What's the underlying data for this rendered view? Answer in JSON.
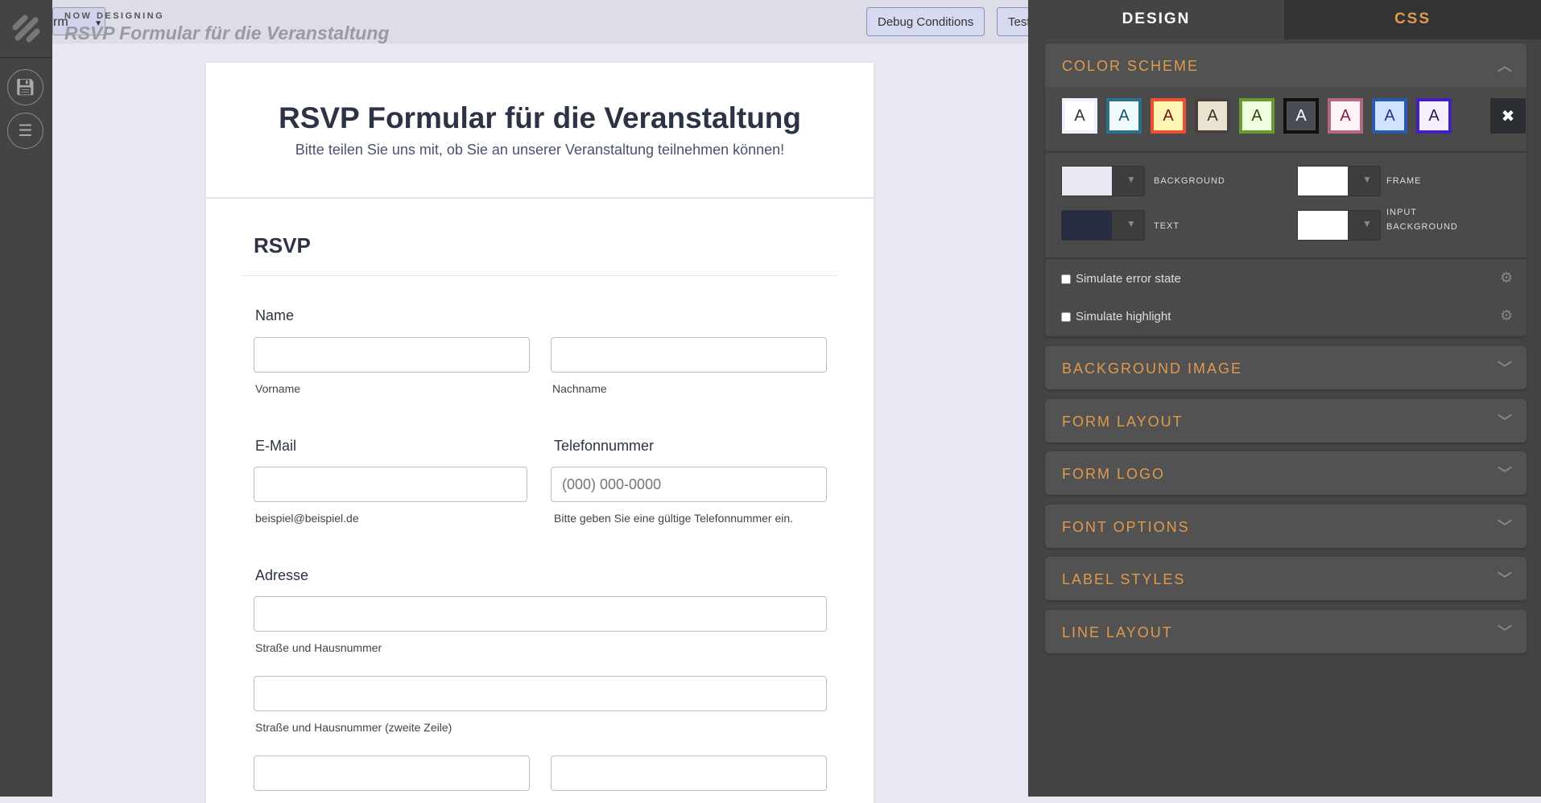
{
  "topbar": {
    "now_designing": "NOW DESIGNING",
    "form_title": "RSVP Formular für die Veranstaltung",
    "form_button_label": "rm",
    "debug_button": "Debug Conditions",
    "test_button": "Test"
  },
  "form": {
    "title": "RSVP Formular für die Veranstaltung",
    "subtitle": "Bitte teilen Sie uns mit, ob Sie an unserer Veranstaltung teilnehmen können!",
    "section": "RSVP",
    "name_label": "Name",
    "first_name_hint": "Vorname",
    "last_name_hint": "Nachname",
    "email_label": "E-Mail",
    "email_hint": "beispiel@beispiel.de",
    "phone_label": "Telefonnummer",
    "phone_placeholder": "(000) 000-0000",
    "phone_hint": "Bitte geben Sie eine gültige Telefonnummer ein.",
    "address_label": "Adresse",
    "street_hint": "Straße und Hausnummer",
    "street2_hint": "Straße und Hausnummer (zweite Zeile)"
  },
  "panel": {
    "tabs": {
      "design": "DESIGN",
      "css": "CSS"
    },
    "color_scheme": {
      "title": "COLOR SCHEME",
      "swatch_letter": "A",
      "swatches": [
        {
          "border": "#eef0fb",
          "bg": "#ffffff",
          "fg": "#2c3345"
        },
        {
          "border": "#2e7088",
          "bg": "#f0fbff",
          "fg": "#15546a"
        },
        {
          "border": "#f05030",
          "bg": "#fff6b6",
          "fg": "#7a1010"
        },
        {
          "border": "#4a4040",
          "bg": "#ebe2d0",
          "fg": "#333333"
        },
        {
          "border": "#6a9a30",
          "bg": "#f0ffe0",
          "fg": "#2a4a10"
        },
        {
          "border": "#111111",
          "bg": "#4a4d58",
          "fg": "#ffffff"
        },
        {
          "border": "#b86688",
          "bg": "#fff5f8",
          "fg": "#8a1a40"
        },
        {
          "border": "#2a5aaa",
          "bg": "#cfe2ff",
          "fg": "#1a3a8a"
        },
        {
          "border": "#4420c0",
          "bg": "#f4f0ff",
          "fg": "#2a1a50"
        }
      ],
      "reset": "✖",
      "background_label": "BACKGROUND",
      "background_color": "#e8e8f2",
      "frame_label": "FRAME",
      "frame_color": "#ffffff",
      "text_label": "TEXT",
      "text_color": "#262d40",
      "input_bg_label_1": "INPUT",
      "input_bg_label_2": "BACKGROUND",
      "input_bg_color": "#ffffff",
      "simulate_error": "Simulate error state",
      "simulate_highlight": "Simulate highlight"
    },
    "sections": [
      "BACKGROUND IMAGE",
      "FORM LAYOUT",
      "FORM LOGO",
      "FONT OPTIONS",
      "LABEL STYLES",
      "LINE LAYOUT"
    ]
  },
  "accent": "#e09a4e"
}
